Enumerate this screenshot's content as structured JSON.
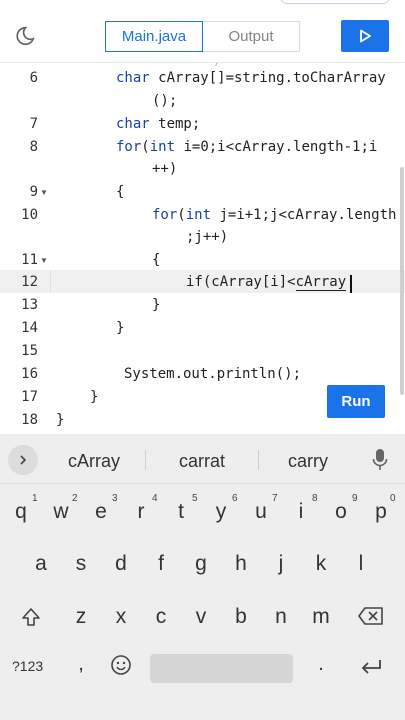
{
  "toolbar": {
    "tab_main": "Main.java",
    "tab_output": "Output"
  },
  "editor": {
    "lines": [
      {
        "num": "6",
        "text": "char cArray[]=string.toCharArray"
      },
      {
        "num": "",
        "text": "();"
      },
      {
        "num": "7",
        "text": "char temp;"
      },
      {
        "num": "8",
        "text": "for(int i=0;i<cArray.length-1;i"
      },
      {
        "num": "",
        "text": "++)"
      },
      {
        "num": "9",
        "text": "{"
      },
      {
        "num": "10",
        "text": "for(int j=i+1;j<cArray.length"
      },
      {
        "num": "",
        "text": ";j++)"
      },
      {
        "num": "11",
        "text": "{"
      },
      {
        "num": "12",
        "text": "if(cArray[i]<"
      },
      {
        "num": "13",
        "text": "}"
      },
      {
        "num": "14",
        "text": "}"
      },
      {
        "num": "15",
        "text": ""
      },
      {
        "num": "16",
        "text": "System.out.println();"
      },
      {
        "num": "17",
        "text": "}"
      },
      {
        "num": "18",
        "text": "}"
      }
    ],
    "composing_word": "cArray",
    "run_label": "Run"
  },
  "keyboard": {
    "suggestions": [
      "cArray",
      "carrat",
      "carry"
    ],
    "row1": [
      "q",
      "w",
      "e",
      "r",
      "t",
      "y",
      "u",
      "i",
      "o",
      "p"
    ],
    "row1_numbers": [
      "1",
      "2",
      "3",
      "4",
      "5",
      "6",
      "7",
      "8",
      "9",
      "0"
    ],
    "row2": [
      "a",
      "s",
      "d",
      "f",
      "g",
      "h",
      "j",
      "k",
      "l"
    ],
    "row3": [
      "z",
      "x",
      "c",
      "v",
      "b",
      "n",
      "m"
    ],
    "symbols_label": "?123",
    "comma": ",",
    "period": "."
  },
  "icons": [
    "moon-icon",
    "play-icon",
    "chevron-right-icon",
    "mic-icon",
    "shift-icon",
    "backspace-icon",
    "emoji-icon",
    "enter-icon"
  ]
}
